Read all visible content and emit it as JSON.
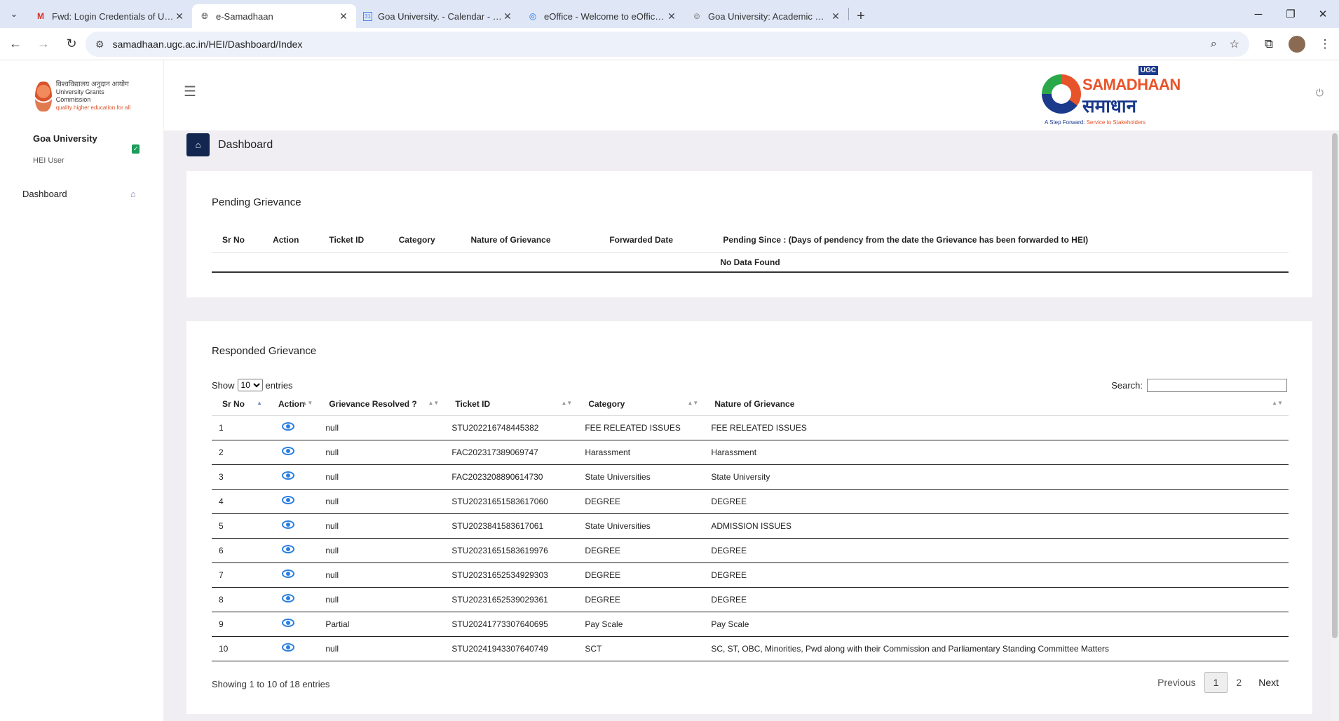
{
  "browser": {
    "tabs": [
      {
        "title": "Fwd: Login Credentials of UGC",
        "favicon": "M",
        "active": false
      },
      {
        "title": "e-Samadhaan",
        "favicon": "globe-icon",
        "active": true
      },
      {
        "title": "Goa University. - Calendar - Ma",
        "favicon": "calendar-icon",
        "active": false
      },
      {
        "title": "eOffice - Welcome to eOffice Su",
        "favicon": "globe-icon",
        "active": false
      },
      {
        "title": "Goa University: Academic Coun",
        "favicon": "podcast-icon",
        "active": false
      }
    ],
    "url": "samadhaan.ugc.ac.in/HEI/Dashboard/Index"
  },
  "sidebar": {
    "logo_hindi": "विश्वविद्यालय अनुदान आयोग",
    "logo_english": "University Grants Commission",
    "logo_tagline": "quality higher education for all",
    "university": "Goa University",
    "role": "HEI User",
    "items": [
      {
        "label": "Dashboard",
        "icon": "home-icon"
      }
    ]
  },
  "header": {
    "logo_badge": "UGC",
    "logo_word": "SAMADHAAN",
    "logo_hindi": "समाधान",
    "logo_tagline_a": "A Step Forward: ",
    "logo_tagline_b": "Service to Stakeholders"
  },
  "page": {
    "title": "Dashboard"
  },
  "pending": {
    "title": "Pending Grievance",
    "columns": [
      "Sr No",
      "Action",
      "Ticket ID",
      "Category",
      "Nature of Grievance",
      "Forwarded Date",
      "Pending Since : (Days of pendency from the date the Grievance has been forwarded to HEI)"
    ],
    "empty": "No Data Found"
  },
  "responded": {
    "title": "Responded Grievance",
    "show_label": "Show",
    "entries_label": "entries",
    "page_size": "10",
    "search_label": "Search:",
    "columns": [
      "Sr No",
      "Action",
      "Grievance Resolved ?",
      "Ticket ID",
      "Category",
      "Nature of Grievance"
    ],
    "rows": [
      {
        "sr": "1",
        "resolved": "null",
        "ticket": "STU202216748445382",
        "category": "FEE RELEATED ISSUES",
        "nature": "FEE RELEATED ISSUES"
      },
      {
        "sr": "2",
        "resolved": "null",
        "ticket": "FAC202317389069747",
        "category": "Harassment",
        "nature": "Harassment"
      },
      {
        "sr": "3",
        "resolved": "null",
        "ticket": "FAC2023208890614730",
        "category": "State Universities",
        "nature": "State University"
      },
      {
        "sr": "4",
        "resolved": "null",
        "ticket": "STU20231651583617060",
        "category": "DEGREE",
        "nature": "DEGREE"
      },
      {
        "sr": "5",
        "resolved": "null",
        "ticket": "STU2023841583617061",
        "category": "State Universities",
        "nature": "ADMISSION ISSUES"
      },
      {
        "sr": "6",
        "resolved": "null",
        "ticket": "STU20231651583619976",
        "category": "DEGREE",
        "nature": "DEGREE"
      },
      {
        "sr": "7",
        "resolved": "null",
        "ticket": "STU20231652534929303",
        "category": "DEGREE",
        "nature": "DEGREE"
      },
      {
        "sr": "8",
        "resolved": "null",
        "ticket": "STU20231652539029361",
        "category": "DEGREE",
        "nature": "DEGREE"
      },
      {
        "sr": "9",
        "resolved": "Partial",
        "ticket": "STU20241773307640695",
        "category": "Pay Scale",
        "nature": "Pay Scale"
      },
      {
        "sr": "10",
        "resolved": "null",
        "ticket": "STU20241943307640749",
        "category": "SCT",
        "nature": "SC, ST, OBC, Minorities, Pwd along with their Commission and Parliamentary Standing Committee Matters"
      }
    ],
    "info": "Showing 1 to 10 of 18 entries",
    "pagination": {
      "previous": "Previous",
      "pages": [
        "1",
        "2"
      ],
      "next": "Next"
    }
  }
}
